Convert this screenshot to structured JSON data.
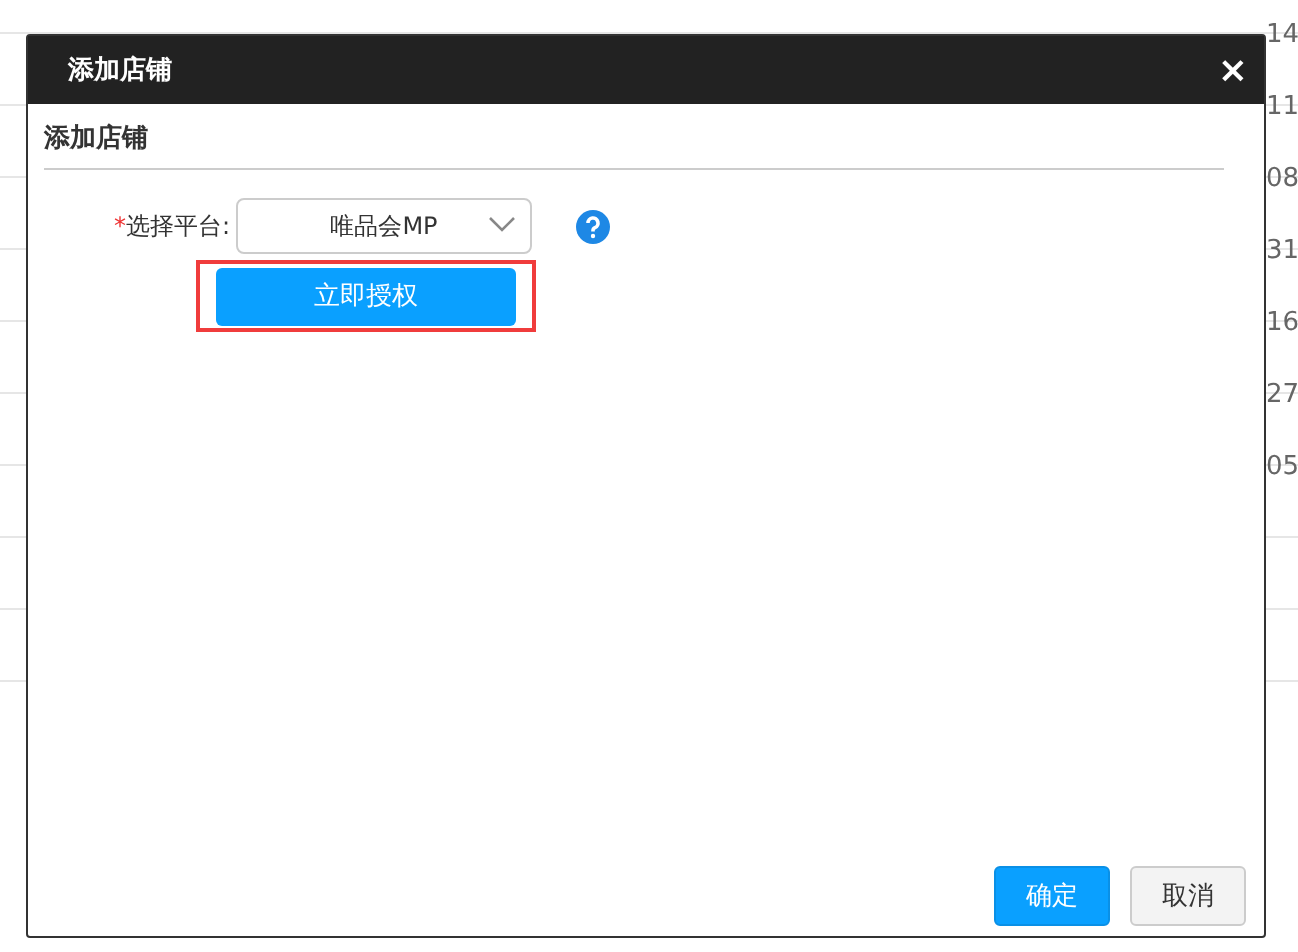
{
  "background_table": {
    "rows": [
      {
        "column_3": "14"
      },
      {
        "column_3": "11"
      },
      {
        "column_3": "08"
      },
      {
        "column_3": "31"
      },
      {
        "column_3": "16"
      },
      {
        "column_3": "27"
      },
      {
        "column_3": "05"
      },
      {},
      {},
      {}
    ]
  },
  "dialog": {
    "title": "添加店铺",
    "close": "×",
    "section_title": "添加店铺",
    "form": {
      "required_mark": "*",
      "label": "选择平台:",
      "platform": "唯品会MP",
      "authorize_button": "立即授权",
      "authorize_highlighted": true
    },
    "buttons": [
      {
        "label": "确定",
        "kind": "primary"
      },
      {
        "label": "取消",
        "kind": "secondary"
      }
    ]
  }
}
